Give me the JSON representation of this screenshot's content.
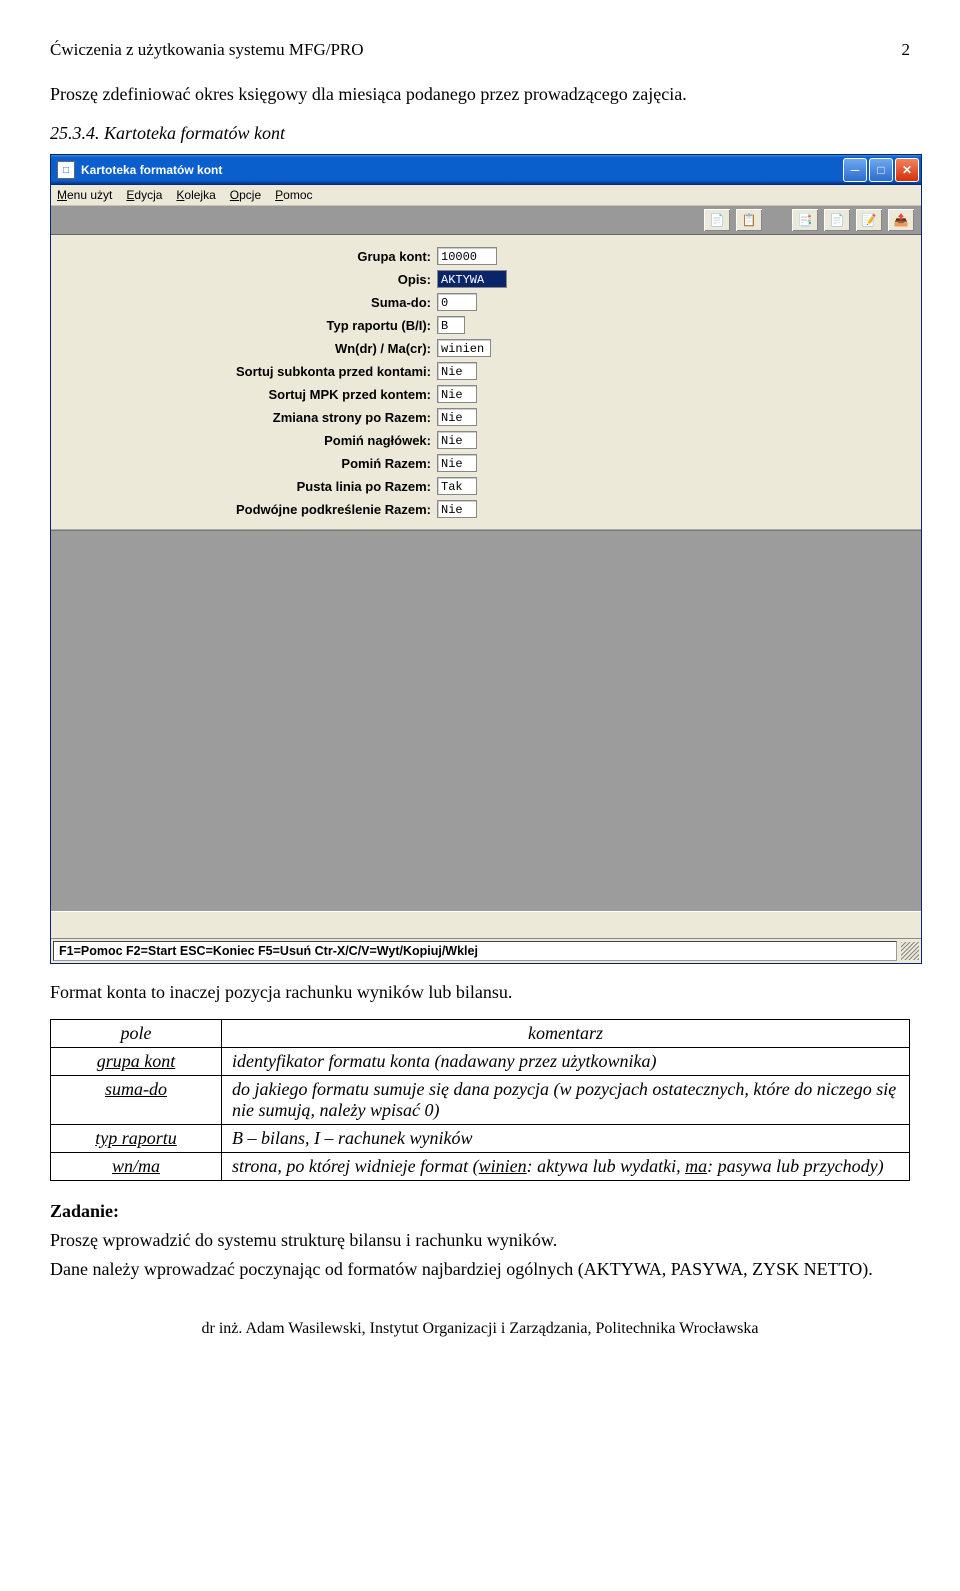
{
  "header": {
    "left": "Ćwiczenia z użytkowania systemu MFG/PRO",
    "right": "2"
  },
  "intro": "Proszę zdefiniować okres księgowy dla miesiąca podanego przez prowadzącego zajęcia.",
  "section_num": "25.3.4. Kartoteka formatów kont",
  "window": {
    "title": "Kartoteka formatów kont",
    "menu": [
      "Menu użyt",
      "Edycja",
      "Kolejka",
      "Opcje",
      "Pomoc"
    ],
    "toolbar_icons": [
      "copy-icon",
      "paste-icon",
      "tool-a-icon",
      "tool-b-icon",
      "tool-c-icon",
      "tool-d-icon"
    ],
    "fields": [
      {
        "label": "Grupa kont:",
        "value": "10000",
        "w": "w60",
        "sel": false
      },
      {
        "label": "Opis:",
        "value": "AKTYWA",
        "w": "w70",
        "sel": true
      },
      {
        "label": "Suma-do:",
        "value": "0",
        "w": "w40",
        "sel": false
      },
      {
        "label": "Typ raportu (B/I):",
        "value": "B",
        "w": "w30",
        "sel": false
      },
      {
        "label": "Wn(dr) / Ma(cr):",
        "value": "winien",
        "w": "w52",
        "sel": false
      },
      {
        "label": "Sortuj subkonta przed kontami:",
        "value": "Nie",
        "w": "w40",
        "sel": false
      },
      {
        "label": "Sortuj MPK przed kontem:",
        "value": "Nie",
        "w": "w40",
        "sel": false
      },
      {
        "label": "Zmiana strony po Razem:",
        "value": "Nie",
        "w": "w40",
        "sel": false
      },
      {
        "label": "Pomiń nagłówek:",
        "value": "Nie",
        "w": "w40",
        "sel": false
      },
      {
        "label": "Pomiń Razem:",
        "value": "Nie",
        "w": "w40",
        "sel": false
      },
      {
        "label": "Pusta linia po Razem:",
        "value": "Tak",
        "w": "w40",
        "sel": false
      },
      {
        "label": "Podwójne podkreślenie Razem:",
        "value": "Nie",
        "w": "w40",
        "sel": false
      }
    ],
    "status": "F1=Pomoc F2=Start ESC=Koniec F5=Usuń Ctr-X/C/V=Wyt/Kopiuj/Wklej"
  },
  "after": "Format konta to inaczej pozycja rachunku wyników lub bilansu.",
  "table": {
    "head": [
      "pole",
      "komentarz"
    ],
    "rows": [
      {
        "k": "grupa kont",
        "v": "identyfikator formatu konta (nadawany przez użytkownika)"
      },
      {
        "k": "suma-do",
        "v": "do jakiego formatu sumuje się dana pozycja (w pozycjach ostatecznych, które do niczego się nie sumują, należy wpisać 0)"
      },
      {
        "k": "typ raportu",
        "v": "B – bilans, I – rachunek wyników"
      },
      {
        "k": "wn/ma",
        "v_html": "strona, po której widnieje format (<span class='u'>winien</span>: aktywa lub wydatki, <span class='u'>ma</span>: pasywa lub przychody)"
      }
    ]
  },
  "task": {
    "label": "Zadanie:",
    "p1": "Proszę wprowadzić do systemu strukturę bilansu i rachunku wyników.",
    "p2": "Dane należy wprowadzać poczynając od formatów najbardziej ogólnych (AKTYWA, PASYWA, ZYSK NETTO)."
  },
  "footer": "dr inż. Adam Wasilewski, Instytut Organizacji i Zarządzania, Politechnika Wrocławska"
}
